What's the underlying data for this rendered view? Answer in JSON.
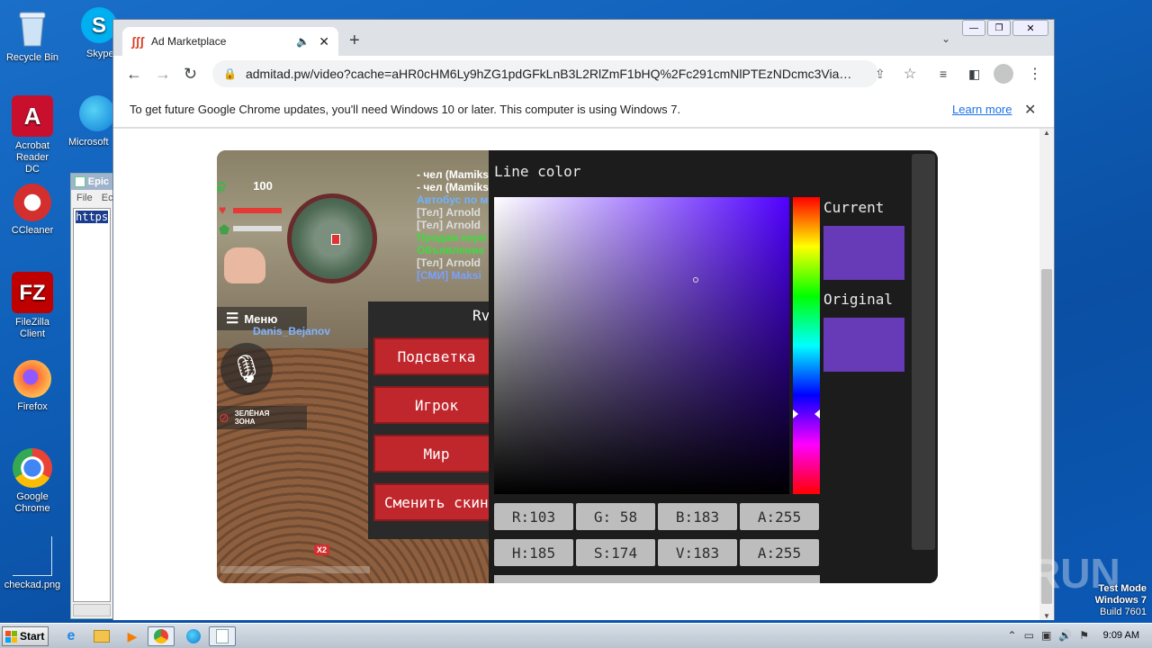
{
  "desktop": {
    "icons": [
      {
        "label": "Recycle Bin"
      },
      {
        "label": "Skype"
      },
      {
        "label": "Acrobat Reader DC"
      },
      {
        "label": "Microsoft"
      },
      {
        "label": "CCleaner"
      },
      {
        "label": "FileZilla Client"
      },
      {
        "label": "Firefox"
      },
      {
        "label": "Google Chrome"
      },
      {
        "label": "checkad.png"
      }
    ],
    "bg_window": {
      "title": "Epic",
      "menu_file": "File",
      "menu_edit": "Ec",
      "text": "https"
    }
  },
  "browser": {
    "tab_title": "Ad Marketplace",
    "url": "admitad.pw/video?cache=aHR0cHM6Ly9hZG1pdGFkLnB3L2RlZmF1bHQ%2Fc291cmNlPTEzNDcmc3ViaWQ9TF...",
    "infobar_text": "To get future Google Chrome updates, you'll need Windows 10 or later. This computer is using Windows 7.",
    "infobar_link": "Learn more"
  },
  "game": {
    "money_symbol": "₽",
    "money": "100",
    "chat": [
      {
        "text": "- чел (Mamiks",
        "color": "#ffffff"
      },
      {
        "text": "- чел (Mamiks",
        "color": "#ffffff"
      },
      {
        "text": "Автобус по м",
        "color": "#6fb3ff"
      },
      {
        "text": "[Тел] Arnold",
        "color": "#dddddd"
      },
      {
        "text": "[Тел] Arnold",
        "color": "#dddddd"
      },
      {
        "text": "Продам корв",
        "color": "#3ddc3d"
      },
      {
        "text": "Объявление",
        "color": "#3ddc3d"
      },
      {
        "text": "[Тел] Arnold",
        "color": "#dddddd"
      },
      {
        "text": "[СМИ] Maksi",
        "color": "#7aa0ff"
      }
    ],
    "menu_label": "Меню",
    "player_name": "Danis_Bejanov",
    "green_zone": "ЗЕЛЁНАЯ ЗОНА",
    "multiplier": "X2",
    "panel_title": "Rv",
    "buttons": [
      "Подсветка",
      "Игрок",
      "Мир",
      "Сменить скин"
    ],
    "picker": {
      "title": "Line color",
      "current_label": "Current",
      "original_label": "Original",
      "current_color": "#673ab7",
      "original_color": "#673ab7",
      "rgba": [
        "R:103",
        "G: 58",
        "B:183",
        "A:255"
      ],
      "hsva": [
        "H:185",
        "S:174",
        "V:183",
        "A:255"
      ]
    }
  },
  "watermark": {
    "brand": "ANY RUN"
  },
  "os_info": {
    "line1": "Test Mode",
    "line2": "Windows 7",
    "line3": "Build 7601"
  },
  "taskbar": {
    "start": "Start",
    "time": "9:09 AM"
  }
}
